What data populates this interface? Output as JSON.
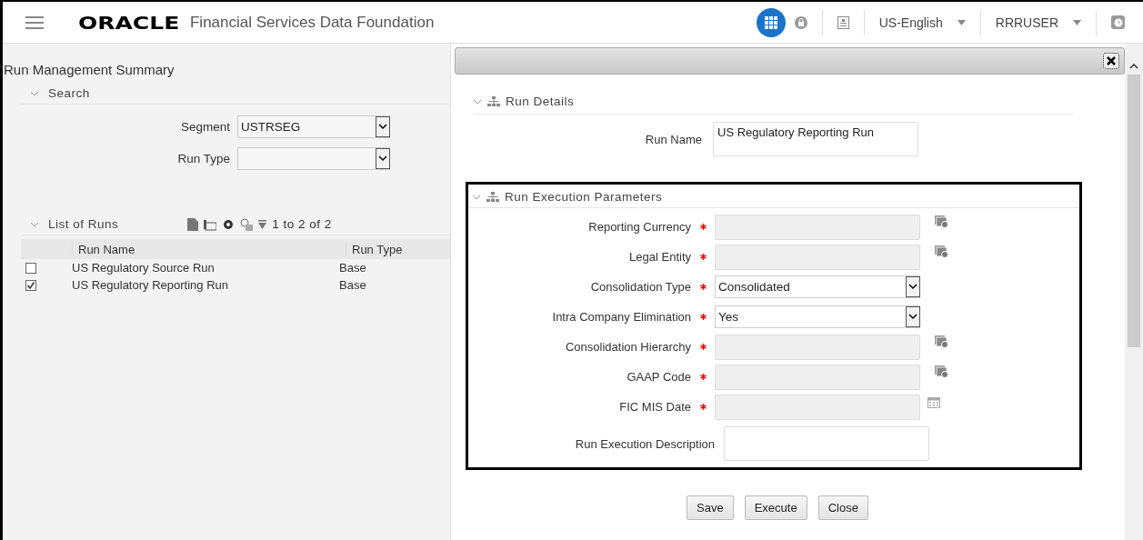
{
  "header": {
    "brand": "ORACLE",
    "product": "Financial Services Data Foundation",
    "language": "US-English",
    "user": "RRRUSER"
  },
  "summary": {
    "title": "Run Management Summary",
    "search": {
      "title": "Search",
      "expanded": true,
      "fields": [
        {
          "label": "Segment",
          "value": "USTRSEG"
        },
        {
          "label": "Run Type"
        }
      ]
    },
    "runs": {
      "title": "List of Runs",
      "expanded": true,
      "pager": "1 to 2 of 2",
      "columns": [
        "Run Name",
        "Run Type"
      ],
      "rows": [
        {
          "name": "US Regulatory Source Run",
          "type": "Base",
          "checked": false
        },
        {
          "name": "US Regulatory Reporting Run",
          "type": "Base",
          "checked": true
        }
      ]
    }
  },
  "details": {
    "title": "Run Details",
    "expanded": true,
    "run_name_label": "Run Name",
    "run_name": "US Regulatory Reporting Run"
  },
  "params": {
    "title": "Run Execution Parameters",
    "expanded": true,
    "fields": [
      {
        "label": "Reporting Currency",
        "required": true,
        "kind": "lookup"
      },
      {
        "label": "Legal Entity",
        "required": true,
        "kind": "lookup"
      },
      {
        "label": "Consolidation Type",
        "required": true,
        "kind": "select",
        "value": "Consolidated"
      },
      {
        "label": "Intra Company Elimination",
        "required": true,
        "kind": "select",
        "value": "Yes"
      },
      {
        "label": "Consolidation Hierarchy",
        "required": true,
        "kind": "lookup"
      },
      {
        "label": "GAAP Code",
        "required": true,
        "kind": "lookup"
      },
      {
        "label": "FIC MIS Date",
        "required": true,
        "kind": "date"
      },
      {
        "label": "Run Execution Description",
        "required": false,
        "kind": "text"
      }
    ]
  },
  "buttons": [
    "Save",
    "Execute",
    "Close"
  ]
}
